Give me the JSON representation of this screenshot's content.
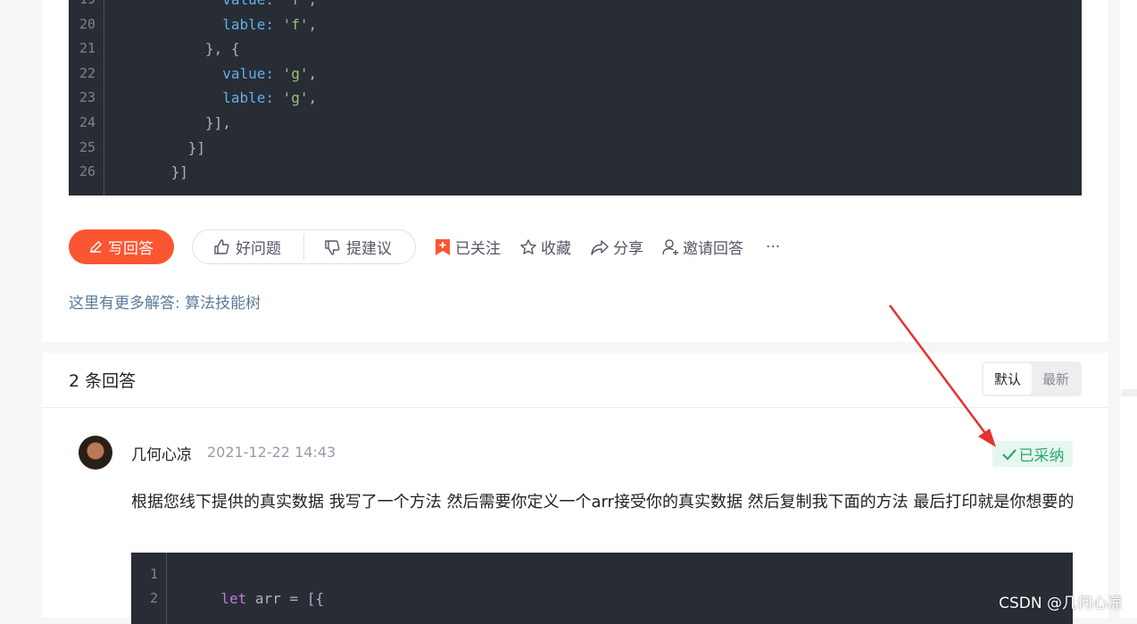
{
  "question_code": {
    "lines": [
      {
        "n": "19",
        "indent": 12,
        "parts": [
          {
            "t": "value:",
            "c": "k"
          },
          {
            "t": " 'f',",
            "c": "s"
          }
        ]
      },
      {
        "n": "20",
        "indent": 12,
        "parts": [
          {
            "t": "lable:",
            "c": "k"
          },
          {
            "t": " ",
            "c": "p"
          },
          {
            "t": "'f'",
            "c": "s"
          },
          {
            "t": ",",
            "c": "p"
          }
        ]
      },
      {
        "n": "21",
        "indent": 10,
        "parts": [
          {
            "t": "}, {",
            "c": "p"
          }
        ]
      },
      {
        "n": "22",
        "indent": 12,
        "parts": [
          {
            "t": "value:",
            "c": "k"
          },
          {
            "t": " ",
            "c": "p"
          },
          {
            "t": "'g'",
            "c": "s"
          },
          {
            "t": ",",
            "c": "p"
          }
        ]
      },
      {
        "n": "23",
        "indent": 12,
        "parts": [
          {
            "t": "lable:",
            "c": "k"
          },
          {
            "t": " ",
            "c": "p"
          },
          {
            "t": "'g'",
            "c": "s"
          },
          {
            "t": ",",
            "c": "p"
          }
        ]
      },
      {
        "n": "24",
        "indent": 10,
        "parts": [
          {
            "t": "}],",
            "c": "p"
          }
        ]
      },
      {
        "n": "25",
        "indent": 8,
        "parts": [
          {
            "t": "}]",
            "c": "p"
          }
        ]
      },
      {
        "n": "26",
        "indent": 6,
        "parts": [
          {
            "t": "}]",
            "c": "p"
          }
        ]
      }
    ]
  },
  "actions": {
    "write_answer": "写回答",
    "good_question": "好问题",
    "suggest": "提建议",
    "followed": "已关注",
    "collect": "收藏",
    "share": "分享",
    "invite": "邀请回答",
    "more": "···"
  },
  "more_link": "这里有更多解答: 算法技能树",
  "answers_header": {
    "count": "2 条回答",
    "sort_default": "默认",
    "sort_newest": "最新"
  },
  "answer": {
    "author": "几何心凉",
    "time": "2021-12-22 14:43",
    "accepted": "已采纳",
    "text": "根据您线下提供的真实数据 我写了一个方法 然后需要你定义一个arr接受你的真实数据 然后复制我下面的方法 最后打印就是你想要的"
  },
  "answer_code": {
    "lines": [
      {
        "n": "1",
        "indent": 0,
        "parts": []
      },
      {
        "n": "2",
        "indent": 4,
        "parts": [
          {
            "t": "let",
            "c": "kw"
          },
          {
            "t": " arr = [{",
            "c": "p"
          }
        ]
      }
    ]
  },
  "watermark": "CSDN @几何心凉",
  "colors": {
    "accent": "#fc5531",
    "accepted_green": "#2ea675",
    "code_bg": "#282c34",
    "arrow_red": "#e5322d"
  }
}
